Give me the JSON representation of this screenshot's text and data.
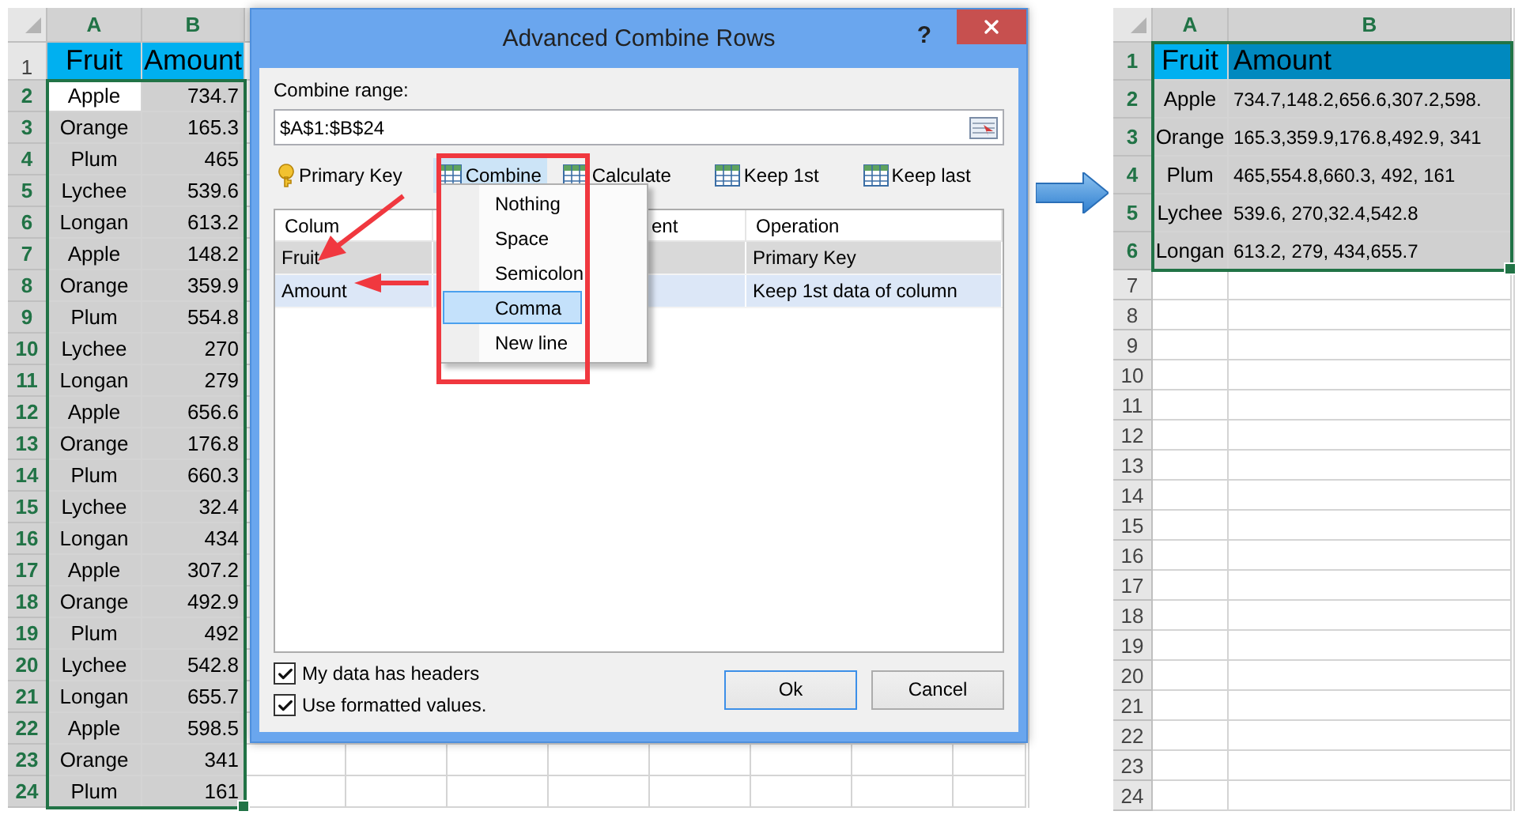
{
  "left_sheet": {
    "columns": [
      {
        "label": "A",
        "selected": true
      },
      {
        "label": "B",
        "selected": true
      }
    ],
    "rows": [
      {
        "number": "1",
        "kind": "header",
        "cells": [
          "Fruit",
          "Amount"
        ],
        "selected": false
      },
      {
        "number": "2",
        "kind": "data",
        "cells": [
          "Apple",
          "734.7"
        ],
        "selected": true,
        "active": true
      },
      {
        "number": "3",
        "kind": "data",
        "cells": [
          "Orange",
          "165.3"
        ],
        "selected": true,
        "active": false
      },
      {
        "number": "4",
        "kind": "data",
        "cells": [
          "Plum",
          "465"
        ],
        "selected": true,
        "active": false
      },
      {
        "number": "5",
        "kind": "data",
        "cells": [
          "Lychee",
          "539.6"
        ],
        "selected": true,
        "active": false
      },
      {
        "number": "6",
        "kind": "data",
        "cells": [
          "Longan",
          "613.2"
        ],
        "selected": true,
        "active": false
      },
      {
        "number": "7",
        "kind": "data",
        "cells": [
          "Apple",
          "148.2"
        ],
        "selected": true,
        "active": false
      },
      {
        "number": "8",
        "kind": "data",
        "cells": [
          "Orange",
          "359.9"
        ],
        "selected": true,
        "active": false
      },
      {
        "number": "9",
        "kind": "data",
        "cells": [
          "Plum",
          "554.8"
        ],
        "selected": true,
        "active": false
      },
      {
        "number": "10",
        "kind": "data",
        "cells": [
          "Lychee",
          "270"
        ],
        "selected": true,
        "active": false
      },
      {
        "number": "11",
        "kind": "data",
        "cells": [
          "Longan",
          "279"
        ],
        "selected": true,
        "active": false
      },
      {
        "number": "12",
        "kind": "data",
        "cells": [
          "Apple",
          "656.6"
        ],
        "selected": true,
        "active": false
      },
      {
        "number": "13",
        "kind": "data",
        "cells": [
          "Orange",
          "176.8"
        ],
        "selected": true,
        "active": false
      },
      {
        "number": "14",
        "kind": "data",
        "cells": [
          "Plum",
          "660.3"
        ],
        "selected": true,
        "active": false
      },
      {
        "number": "15",
        "kind": "data",
        "cells": [
          "Lychee",
          "32.4"
        ],
        "selected": true,
        "active": false
      },
      {
        "number": "16",
        "kind": "data",
        "cells": [
          "Longan",
          "434"
        ],
        "selected": true,
        "active": false
      },
      {
        "number": "17",
        "kind": "data",
        "cells": [
          "Apple",
          "307.2"
        ],
        "selected": true,
        "active": false
      },
      {
        "number": "18",
        "kind": "data",
        "cells": [
          "Orange",
          "492.9"
        ],
        "selected": true,
        "active": false
      },
      {
        "number": "19",
        "kind": "data",
        "cells": [
          "Plum",
          "492"
        ],
        "selected": true,
        "active": false
      },
      {
        "number": "20",
        "kind": "data",
        "cells": [
          "Lychee",
          "542.8"
        ],
        "selected": true,
        "active": false
      },
      {
        "number": "21",
        "kind": "data",
        "cells": [
          "Longan",
          "655.7"
        ],
        "selected": true,
        "active": false
      },
      {
        "number": "22",
        "kind": "data",
        "cells": [
          "Apple",
          "598.5"
        ],
        "selected": true,
        "active": false
      },
      {
        "number": "23",
        "kind": "data",
        "cells": [
          "Orange",
          "341"
        ],
        "selected": true,
        "active": false
      },
      {
        "number": "24",
        "kind": "data",
        "cells": [
          "Plum",
          "161"
        ],
        "selected": true,
        "active": false
      }
    ]
  },
  "dialog": {
    "title": "Advanced Combine Rows",
    "help": "?",
    "range_label": "Combine range:",
    "range_value": "$A$1:$B$24",
    "toolbar": [
      {
        "label": "Primary Key",
        "kind": "key",
        "selected": false
      },
      {
        "label": "Combine",
        "kind": "table",
        "selected": true
      },
      {
        "label": "Calculate",
        "kind": "table",
        "selected": false
      },
      {
        "label": "Keep 1st",
        "kind": "table",
        "selected": false
      },
      {
        "label": "Keep last",
        "kind": "table",
        "selected": false
      }
    ],
    "table": {
      "columns": [
        "Colum",
        "ent",
        "Operation"
      ],
      "rows": [
        {
          "column": "Fruit",
          "operation": "Primary Key",
          "selected": false
        },
        {
          "column": "Amount",
          "operation": "Keep 1st data of column",
          "selected": true
        }
      ]
    },
    "menu": [
      {
        "label": "Nothing",
        "selected": false
      },
      {
        "label": "Space",
        "selected": false
      },
      {
        "label": "Semicolon",
        "selected": false
      },
      {
        "label": "Comma",
        "selected": true
      },
      {
        "label": "New line",
        "selected": false
      }
    ],
    "options": [
      {
        "label": "My data has headers",
        "checked": true
      },
      {
        "label": "Use formatted values.",
        "checked": true
      }
    ],
    "buttons": [
      {
        "label": "Ok",
        "default": true
      },
      {
        "label": "Cancel",
        "default": false
      }
    ]
  },
  "right_sheet": {
    "columns": [
      {
        "label": "A",
        "selected": true
      },
      {
        "label": "B",
        "selected": true
      }
    ],
    "rows": [
      {
        "number": "1",
        "kind": "header",
        "cells": [
          "Fruit",
          "Amount"
        ],
        "selected": true,
        "active": true
      },
      {
        "number": "2",
        "kind": "data",
        "cells": [
          "Apple",
          "734.7,148.2,656.6,307.2,598."
        ],
        "selected": true,
        "active": false
      },
      {
        "number": "3",
        "kind": "data",
        "cells": [
          "Orange",
          "165.3,359.9,176.8,492.9, 341"
        ],
        "selected": true,
        "active": false
      },
      {
        "number": "4",
        "kind": "data",
        "cells": [
          "Plum",
          "465,554.8,660.3, 492, 161"
        ],
        "selected": true,
        "active": false
      },
      {
        "number": "5",
        "kind": "data",
        "cells": [
          "Lychee",
          "539.6, 270,32.4,542.8"
        ],
        "selected": true,
        "active": false
      },
      {
        "number": "6",
        "kind": "data",
        "cells": [
          "Longan",
          "613.2, 279, 434,655.7"
        ],
        "selected": true,
        "active": false
      },
      {
        "number": "7",
        "kind": "empty",
        "selected": false
      },
      {
        "number": "8",
        "kind": "empty",
        "selected": false
      },
      {
        "number": "9",
        "kind": "empty",
        "selected": false
      },
      {
        "number": "10",
        "kind": "empty",
        "selected": false
      },
      {
        "number": "11",
        "kind": "empty",
        "selected": false
      },
      {
        "number": "12",
        "kind": "empty",
        "selected": false
      },
      {
        "number": "13",
        "kind": "empty",
        "selected": false
      },
      {
        "number": "14",
        "kind": "empty",
        "selected": false
      },
      {
        "number": "15",
        "kind": "empty",
        "selected": false
      },
      {
        "number": "16",
        "kind": "empty",
        "selected": false
      },
      {
        "number": "17",
        "kind": "empty",
        "selected": false
      },
      {
        "number": "18",
        "kind": "empty",
        "selected": false
      },
      {
        "number": "19",
        "kind": "empty",
        "selected": false
      },
      {
        "number": "20",
        "kind": "empty",
        "selected": false
      },
      {
        "number": "21",
        "kind": "empty",
        "selected": false
      },
      {
        "number": "22",
        "kind": "empty",
        "selected": false
      },
      {
        "number": "23",
        "kind": "empty",
        "selected": false
      },
      {
        "number": "24",
        "kind": "empty",
        "selected": false
      }
    ]
  }
}
